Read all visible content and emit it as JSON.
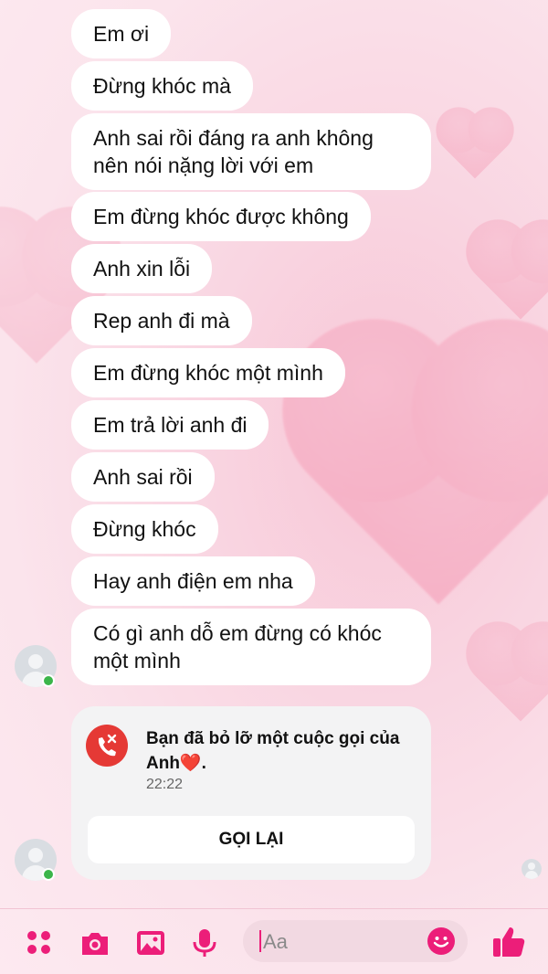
{
  "messages": [
    "Em ơi",
    "Đừng khóc mà",
    "Anh sai rồi đáng ra anh không nên nói nặng lời với em",
    "Em đừng khóc được không",
    "Anh xin lỗi",
    "Rep anh đi mà",
    "Em đừng khóc một mình",
    "Em trả lời anh đi",
    "Anh sai rồi",
    "Đừng khóc",
    "Hay anh điện em nha",
    "Có gì anh dỗ em đừng có khóc một mình"
  ],
  "call": {
    "text": "Bạn đã bỏ lỡ một cuộc gọi của Anh❤️.",
    "time": "22:22",
    "callback_label": "GỌI LẠI"
  },
  "composer": {
    "placeholder": "Aa"
  },
  "colors": {
    "accent": "#ec1e79",
    "missed_call": "#e53935",
    "online": "#3bb54a",
    "bubble": "#ffffff"
  },
  "icons": [
    "menu-dots-icon",
    "camera-icon",
    "gallery-icon",
    "microphone-icon",
    "emoji-icon",
    "thumbs-up-icon",
    "missed-call-icon"
  ]
}
